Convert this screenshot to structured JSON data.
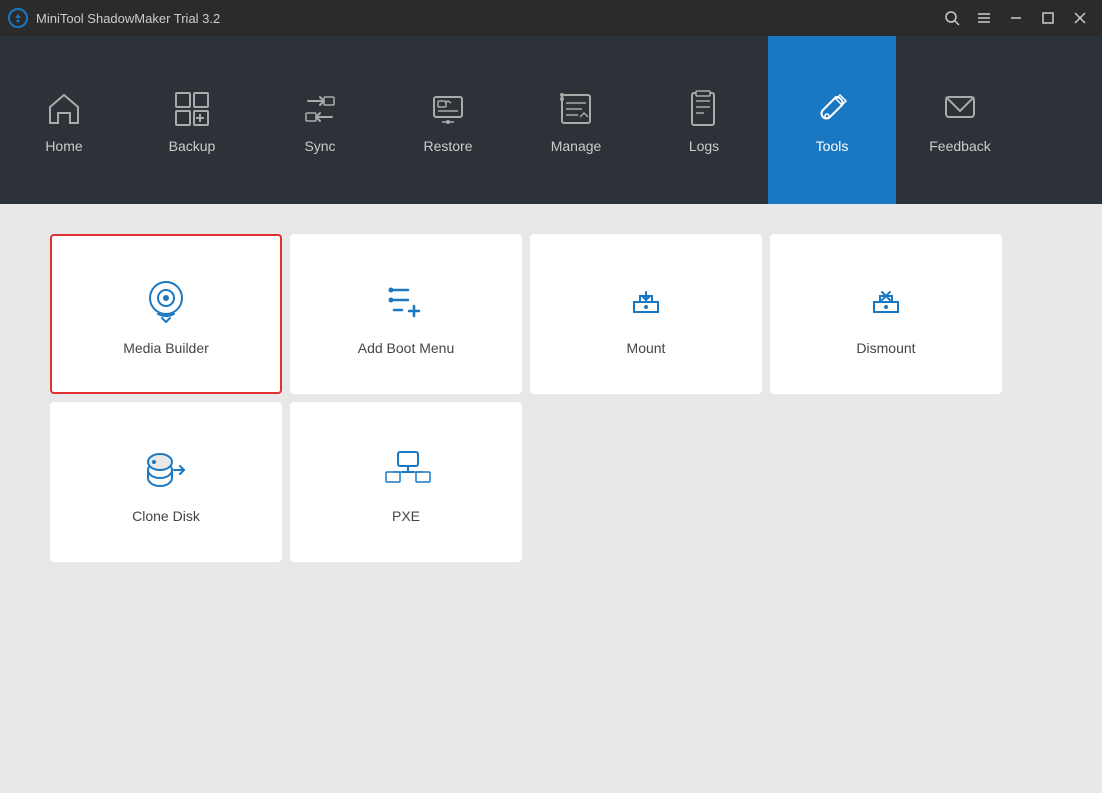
{
  "app": {
    "title": "MiniTool ShadowMaker Trial 3.2"
  },
  "titlebar": {
    "search_icon": "🔍",
    "menu_icon": "≡",
    "minimize_label": "−",
    "maximize_label": "□",
    "close_label": "✕"
  },
  "nav": {
    "items": [
      {
        "id": "home",
        "label": "Home"
      },
      {
        "id": "backup",
        "label": "Backup"
      },
      {
        "id": "sync",
        "label": "Sync"
      },
      {
        "id": "restore",
        "label": "Restore"
      },
      {
        "id": "manage",
        "label": "Manage"
      },
      {
        "id": "logs",
        "label": "Logs"
      },
      {
        "id": "tools",
        "label": "Tools",
        "active": true
      },
      {
        "id": "feedback",
        "label": "Feedback"
      }
    ]
  },
  "tools": {
    "row1": [
      {
        "id": "media-builder",
        "label": "Media Builder",
        "selected": true
      },
      {
        "id": "add-boot-menu",
        "label": "Add Boot Menu",
        "selected": false
      },
      {
        "id": "mount",
        "label": "Mount",
        "selected": false
      },
      {
        "id": "dismount",
        "label": "Dismount",
        "selected": false
      }
    ],
    "row2": [
      {
        "id": "clone-disk",
        "label": "Clone Disk",
        "selected": false
      },
      {
        "id": "pxe",
        "label": "PXE",
        "selected": false
      }
    ]
  }
}
